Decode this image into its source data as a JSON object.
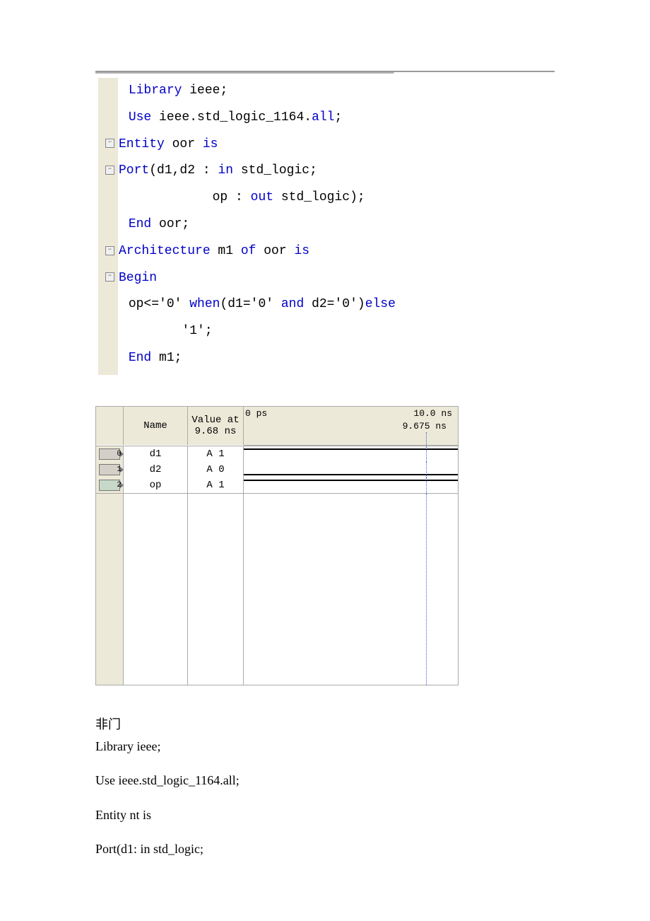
{
  "code": {
    "l1_kw": "Library",
    "l1_rest": " ieee;",
    "l2_kw": "Use",
    "l2_rest": " ieee.std_logic_1164.",
    "l2_kw2": "all",
    "l2_end": ";",
    "l3_kw": "Entity",
    "l3_rest": " oor ",
    "l3_kw2": "is",
    "l4_kw": "Port",
    "l4_rest": "(d1,d2 : ",
    "l4_kw2": "in",
    "l4_rest2": " std_logic;",
    "l5": "            op : ",
    "l5_kw": "out",
    "l5_rest": " std_logic);",
    "l6_kw": "End",
    "l6_rest": " oor;",
    "l7_kw": "Architecture",
    "l7_rest": " m1 ",
    "l7_kw2": "of",
    "l7_rest2": " oor ",
    "l7_kw3": "is",
    "l8_kw": "Begin",
    "l9": "op<='0' ",
    "l9_kw": "when",
    "l9_rest": "(d1='0' ",
    "l9_kw2": "and",
    "l9_rest2": " d2='0')",
    "l9_kw3": "else",
    "l10": "        '1';",
    "l11_kw": "End",
    "l11_rest": " m1;"
  },
  "waveform": {
    "name_header": "Name",
    "value_header_l1": "Value at",
    "value_header_l2": "9.68 ns",
    "ruler_start": "0 ps",
    "ruler_end": "10.0 ns",
    "cursor_label": "9.675 ns",
    "rows": [
      {
        "pin": "0",
        "name": "d1",
        "value": "A 1"
      },
      {
        "pin": "1",
        "name": "d2",
        "value": "A 0"
      },
      {
        "pin": "2",
        "name": "op",
        "value": "A 1"
      }
    ]
  },
  "text": {
    "title": "非门",
    "l1": "Library ieee;",
    "l2": "Use ieee.std_logic_1164.all;",
    "l3": "Entity nt is",
    "l4": "Port(d1: in std_logic;"
  }
}
